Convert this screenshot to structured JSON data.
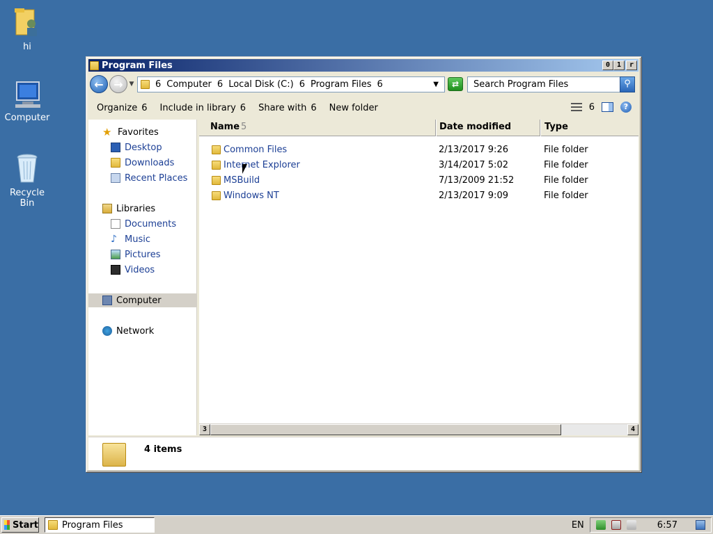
{
  "desktop": {
    "icons": [
      {
        "label": "hi"
      },
      {
        "label": "Computer"
      },
      {
        "label": "Recycle\nBin"
      }
    ]
  },
  "window": {
    "title": "Program Files",
    "controls": {
      "minimize": "0",
      "maximize": "1",
      "close": "r"
    }
  },
  "address": {
    "sep": "6",
    "crumbs": [
      "Computer",
      "Local Disk (C:)",
      "Program Files"
    ],
    "dropdown_glyph": "▼"
  },
  "search": {
    "placeholder": "Search Program Files"
  },
  "commandbar": {
    "organize": "Organize",
    "include": "Include in library",
    "share": "Share with",
    "newfolder": "New folder",
    "arrow": "6"
  },
  "nav": {
    "favorites": "Favorites",
    "desktop": "Desktop",
    "downloads": "Downloads",
    "recent": "Recent Places",
    "libraries": "Libraries",
    "documents": "Documents",
    "music": "Music",
    "pictures": "Pictures",
    "videos": "Videos",
    "computer": "Computer",
    "network": "Network"
  },
  "columns": {
    "name": "Name",
    "name_sort": "5",
    "date": "Date modified",
    "type": "Type"
  },
  "files": [
    {
      "name": "Common Files",
      "date": "2/13/2017 9:26",
      "type": "File folder"
    },
    {
      "name": "Internet Explorer",
      "date": "3/14/2017 5:02",
      "type": "File folder"
    },
    {
      "name": "MSBuild",
      "date": "7/13/2009 21:52",
      "type": "File folder"
    },
    {
      "name": "Windows NT",
      "date": "2/13/2017 9:09",
      "type": "File folder"
    }
  ],
  "scroll": {
    "left": "3",
    "right": "4"
  },
  "details": {
    "count": "4 items"
  },
  "taskbar": {
    "start": "Start",
    "task": "Program Files",
    "lang": "EN",
    "clock": "6:57"
  },
  "colors": {
    "desktop": "#3a6ea5",
    "link": "#1c3f95"
  }
}
